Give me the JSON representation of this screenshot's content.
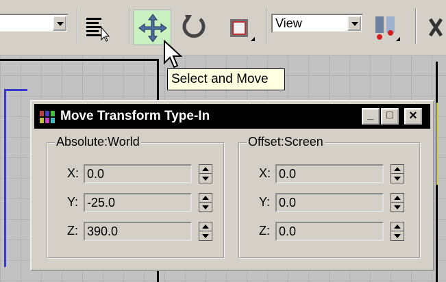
{
  "toolbar": {
    "view_dropdown": {
      "value": "View"
    },
    "tools": [
      {
        "name": "select-by-name",
        "icon": "list-select-icon"
      },
      {
        "name": "select-and-move",
        "icon": "move-icon",
        "active": true
      },
      {
        "name": "select-and-rotate",
        "icon": "rotate-icon"
      },
      {
        "name": "select-and-scale",
        "icon": "scale-icon"
      },
      {
        "name": "use-pivot-center",
        "icon": "pivot-icon"
      },
      {
        "name": "mirror",
        "icon": "mirror-icon"
      }
    ]
  },
  "tooltip": {
    "text": "Select and Move"
  },
  "dialog": {
    "title": "Move Transform Type-In",
    "controls": {
      "minimize": "_",
      "maximize": "□",
      "close": "×"
    },
    "absolute": {
      "label": "Absolute:World",
      "x_label": "X:",
      "x": "0.0",
      "y_label": "Y:",
      "y": "-25.0",
      "z_label": "Z:",
      "z": "390.0"
    },
    "offset": {
      "label": "Offset:Screen",
      "x_label": "X:",
      "x": "0.0",
      "y_label": "Y:",
      "y": "0.0",
      "z_label": "Z:",
      "z": "0.0"
    }
  },
  "colors": {
    "toolbar_bg": "#d4d0c8",
    "active_tool_bg": "#c8f0c0",
    "tooltip_bg": "#ffffe1",
    "titlebar_bg": "#000000"
  }
}
